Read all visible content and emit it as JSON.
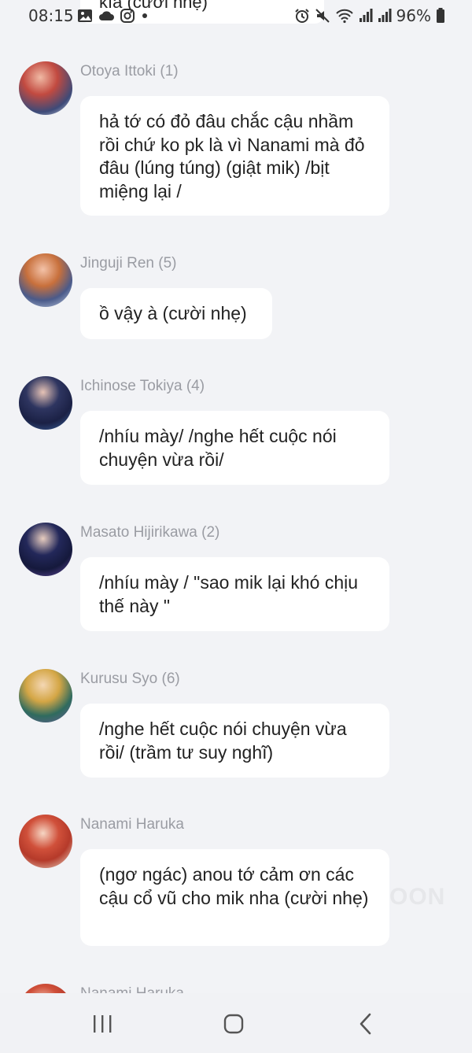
{
  "status_bar": {
    "time": "08:15",
    "battery": "96%"
  },
  "top_partial_message": "kìa (cười nhẹ)",
  "messages": [
    {
      "sender": "Otoya Ittoki (1)",
      "text": "hả tớ có đỏ đâu chắc cậu nhầm rồi chứ ko pk là vì Nanami mà đỏ đâu (lúng túng) (giật mik) /bịt miệng lại /",
      "avatar_color": "#b8413a"
    },
    {
      "sender": "Jinguji Ren (5)",
      "text": "ồ vậy à (cười nhẹ)",
      "avatar_color": "#c56b3a"
    },
    {
      "sender": "Ichinose Tokiya (4)",
      "text": "/nhíu mày/ /nghe hết cuộc nói chuyện vừa rồi/",
      "avatar_color": "#2a2f5a"
    },
    {
      "sender": "Masato Hijirikawa (2)",
      "text": "/nhíu mày / \"sao mik lại khó chịu thế này \"",
      "avatar_color": "#1f2448"
    },
    {
      "sender": "Kurusu Syo (6)",
      "text": "/nghe hết cuộc nói chuyện vừa rồi/ (trầm tư suy nghĩ)",
      "avatar_color": "#c79a3c"
    },
    {
      "sender": "Nanami Haruka",
      "text": "(ngơ ngác) anou tớ cảm ơn các cậu cổ vũ cho mik nha (cười nhẹ)",
      "avatar_color": "#c8452f"
    },
    {
      "sender": "Nanami Haruka",
      "text": "",
      "avatar_color": "#c8452f"
    }
  ],
  "watermark": "OON",
  "icons": {
    "gallery": "image-icon",
    "cloud": "cloud-icon",
    "instagram": "instagram-icon",
    "alarm": "alarm-icon",
    "mute": "mute-icon",
    "wifi": "wifi-icon",
    "signal": "signal-icon",
    "battery": "battery-icon",
    "recents": "recents-icon",
    "home": "home-icon",
    "back": "back-icon"
  }
}
